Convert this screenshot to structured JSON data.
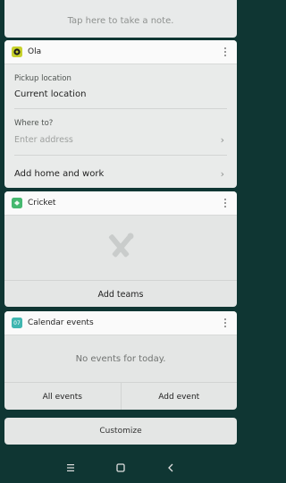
{
  "note": {
    "placeholder": "Tap here to take a note."
  },
  "ola": {
    "title": "Ola",
    "pickup_label": "Pickup location",
    "pickup_value": "Current location",
    "destination_label": "Where to?",
    "destination_placeholder": "Enter address",
    "home_work_label": "Add home and work"
  },
  "cricket": {
    "title": "Cricket",
    "add_teams_label": "Add teams"
  },
  "calendar": {
    "icon_day": "07",
    "title": "Calendar events",
    "empty_message": "No events for today.",
    "all_events_label": "All events",
    "add_event_label": "Add event"
  },
  "customize_label": "Customize",
  "colors": {
    "background": "#0f3633",
    "ola_accent": "#c7d12b",
    "cricket_accent": "#45b86f",
    "calendar_accent": "#3fb6b0"
  },
  "icons": {
    "ola": "ola-logo-icon",
    "cricket": "cricket-bats-icon",
    "calendar": "calendar-day-icon",
    "nav_menu": "menu-icon",
    "nav_home": "home-square-icon",
    "nav_back": "back-icon"
  }
}
